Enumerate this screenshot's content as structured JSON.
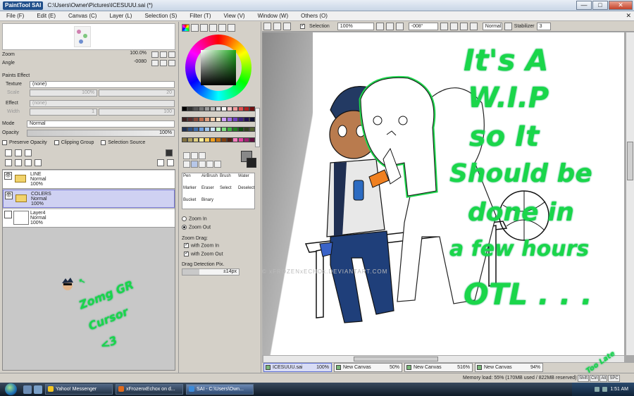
{
  "window": {
    "app_logo": "PaintTool SAI",
    "title": "C:\\Users\\Owner\\Pictures\\ICESUUU.sai (*)",
    "minimize": "—",
    "maximize": "□",
    "close": "✕"
  },
  "menu": {
    "items": [
      "File (F)",
      "Edit (E)",
      "Canvas (C)",
      "Layer (L)",
      "Selection (S)",
      "Filter (T)",
      "View (V)",
      "Window (W)",
      "Others (O)"
    ],
    "close_doc": "✕"
  },
  "navigator": {
    "zoom_label": "Zoom",
    "zoom_value": "100.0%",
    "angle_label": "Angle",
    "angle_value": "-0080"
  },
  "paints_effect": {
    "header": "Paints Effect",
    "texture_label": "Texture",
    "texture_value": "(none)",
    "scale_label": "Scale",
    "scale_value": "100%",
    "scale_right": "20",
    "effect_label": "Effect",
    "effect_value": "(none)",
    "width_label": "Width",
    "width_value": "1",
    "width_right": "100"
  },
  "layer_props": {
    "mode_label": "Mode",
    "mode_value": "Normal",
    "opacity_label": "Opacity",
    "opacity_value": "100%",
    "preserve_opacity": "Preserve Opacity",
    "clipping_group": "Clipping Group",
    "selection_source": "Selection Source"
  },
  "layers": [
    {
      "name": "LINE",
      "mode": "Normal",
      "opacity": "100%",
      "type": "folder",
      "visible": true,
      "selected": false
    },
    {
      "name": "COLERS",
      "mode": "Normal",
      "opacity": "100%",
      "type": "folder",
      "visible": true,
      "selected": true
    },
    {
      "name": "Layer4",
      "mode": "Normal",
      "opacity": "100%",
      "type": "layer",
      "visible": false,
      "selected": false
    }
  ],
  "left_annotation": [
    "Zomg GR",
    "Cursor",
    "<3"
  ],
  "brushes": [
    [
      "Pen",
      "AirBrush",
      "Brush",
      "Water"
    ],
    [
      "Marker",
      "Eraser",
      "Select",
      "Deselect"
    ],
    [
      "Bucket",
      "Binary",
      "",
      ""
    ]
  ],
  "zoom_tool": {
    "zoom_in": "Zoom In",
    "zoom_out": "Zoom Out",
    "zoom_drag": "Zoom Drag:",
    "with_zoom_in": "with Zoom In",
    "with_zoom_out": "with Zoom Out",
    "detection_label": "Drag Detection Pix.",
    "detection_value": "±14px"
  },
  "canvas_toolbar": {
    "selection_label": "Selection",
    "zoom": "100%",
    "angle": "-008°",
    "blend": "Normal",
    "stabilizer_label": "Stabilizer",
    "stabilizer_value": "3"
  },
  "canvas_text": {
    "big_note": [
      "It's A",
      "W.I.P",
      "so It",
      "Should be",
      "done in",
      "a few hours",
      "OTL . . ."
    ],
    "watermark": "© xFROZENxECHOx.DEVIANTART.COM",
    "corner_note": "Too Late"
  },
  "canvas_tabs": [
    {
      "name": "ICESUUU.sai",
      "zoom": "100%",
      "active": true
    },
    {
      "name": "New Canvas",
      "zoom": "50%",
      "active": false
    },
    {
      "name": "New Canvas",
      "zoom": "516%",
      "active": false
    },
    {
      "name": "New Canvas",
      "zoom": "94%",
      "active": false
    }
  ],
  "status": {
    "memory": "Memory load: 55% (170MB used / 822MB reserved)",
    "keys": [
      "Shift",
      "Ctrl",
      "Alt",
      "SPC"
    ]
  },
  "taskbar": {
    "tasks": [
      {
        "label": "Yahoo! Messenger",
        "active": false,
        "color": "#f3c522"
      },
      {
        "label": "xFrozenxEchox on d...",
        "active": false,
        "color": "#e06a1b"
      },
      {
        "label": "SAI - C:\\Users\\Own...",
        "active": true,
        "color": "#3b8ad8"
      }
    ],
    "clock": "1:51 AM"
  },
  "colors": {
    "accent_green": "#1ad64a",
    "selected_layer": "#cfd1f2"
  }
}
